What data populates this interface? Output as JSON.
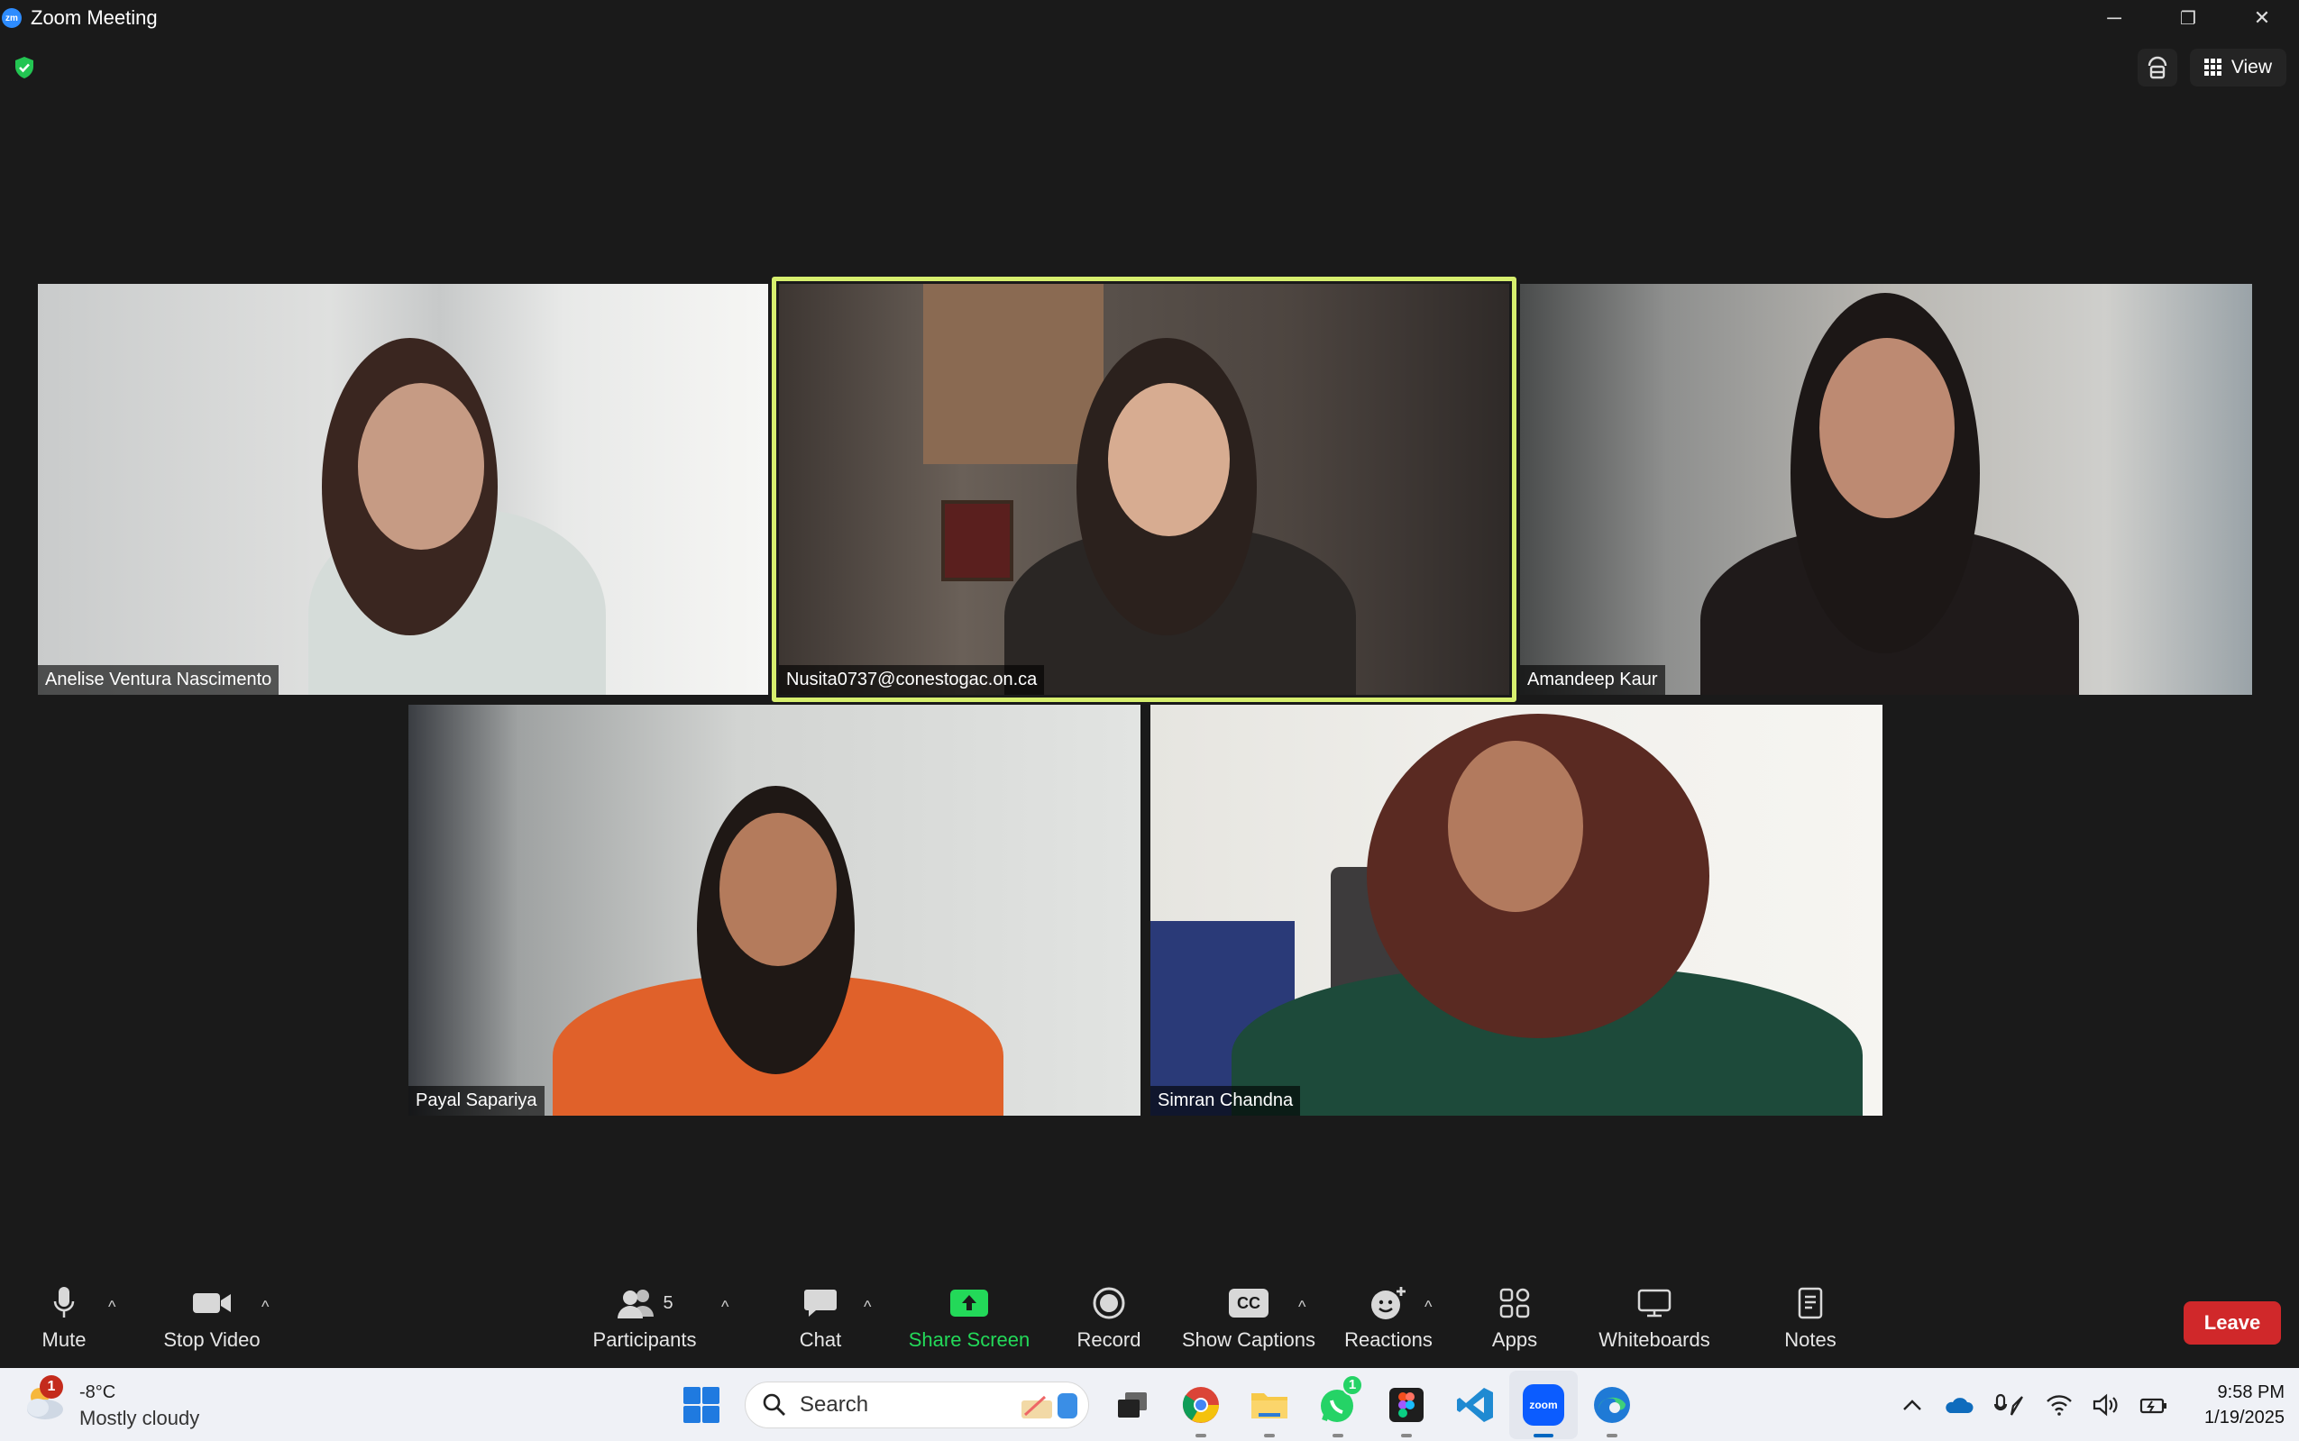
{
  "window": {
    "title": "Zoom Meeting",
    "logo_text": "zm",
    "minimize": "─",
    "restore": "❐",
    "close": "✕"
  },
  "top_right": {
    "view_label": "View"
  },
  "participants": [
    {
      "name": "Anelise Ventura Nascimento"
    },
    {
      "name": "Nusita0737@conestogac.on.ca"
    },
    {
      "name": "Amandeep Kaur"
    },
    {
      "name": "Payal Sapariya"
    },
    {
      "name": "Simran Chandna"
    }
  ],
  "toolbar": {
    "mute": "Mute",
    "stop_video": "Stop Video",
    "participants": "Participants",
    "participants_count": "5",
    "chat": "Chat",
    "share_screen": "Share Screen",
    "record": "Record",
    "show_captions": "Show Captions",
    "cc_text": "CC",
    "reactions": "Reactions",
    "apps": "Apps",
    "whiteboards": "Whiteboards",
    "notes": "Notes",
    "leave": "Leave",
    "caret": "^"
  },
  "taskbar": {
    "weather_badge": "1",
    "weather_temp": "-8°C",
    "weather_desc": "Mostly cloudy",
    "search_placeholder": "Search",
    "whatsapp_badge": "1",
    "zoom_text": "zoom",
    "time": "9:58 PM",
    "date": "1/19/2025"
  },
  "colors": {
    "background": "#1a1a1a",
    "active_speaker_border": "#d7ef6e",
    "share_screen": "#23d959",
    "leave": "#d0282a",
    "taskbar": "#eff1f6"
  }
}
